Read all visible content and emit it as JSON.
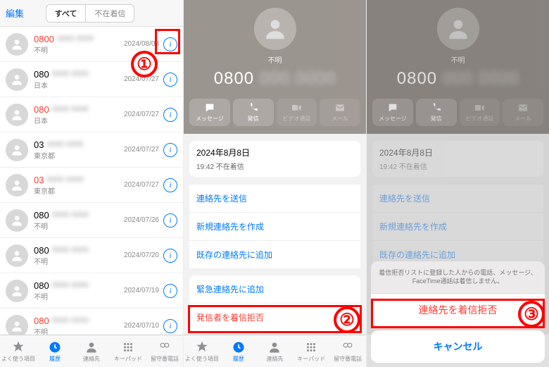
{
  "panel1": {
    "edit": "編集",
    "seg_all": "すべて",
    "seg_missed": "不在着信",
    "rows": [
      {
        "num": "0800",
        "missed": true,
        "sub": "不明",
        "date": "2024/08/08"
      },
      {
        "num": "080",
        "missed": false,
        "sub": "日本",
        "date": "2024/07/27"
      },
      {
        "num": "080",
        "missed": true,
        "sub": "日本",
        "date": "2024/07/27"
      },
      {
        "num": "03",
        "missed": false,
        "sub": "東京都",
        "date": "2024/07/27"
      },
      {
        "num": "03",
        "missed": true,
        "sub": "東京都",
        "date": "2024/07/27"
      },
      {
        "num": "080",
        "missed": false,
        "sub": "不明",
        "date": "2024/07/26"
      },
      {
        "num": "080",
        "missed": false,
        "sub": "不明",
        "date": "2024/07/20"
      },
      {
        "num": "080",
        "missed": false,
        "sub": "不明",
        "date": "2024/07/19"
      },
      {
        "num": "080",
        "missed": true,
        "sub": "不明",
        "date": "2024/07/10"
      }
    ],
    "tabs": [
      "よく使う項目",
      "履歴",
      "連絡先",
      "キーパッド",
      "留守番電話"
    ]
  },
  "contact": {
    "name": "不明",
    "number": "0800",
    "actions": [
      {
        "label": "メッセージ"
      },
      {
        "label": "発信"
      },
      {
        "label": "ビデオ通話"
      },
      {
        "label": "メール"
      }
    ],
    "date_line": "2024年8月8日",
    "time_line": "19:42  不在着信",
    "opts": {
      "share": "連絡先を送信",
      "newc": "新規連絡先を作成",
      "addc": "既存の連絡先に追加",
      "emerg": "緊急連絡先に追加",
      "block": "発信者を着信拒否"
    }
  },
  "sheet": {
    "warn": "着信拒否リストに登録した人からの電話、メッセージ、FaceTime通話は着信しません。",
    "block": "連絡先を着信拒否",
    "cancel": "キャンセル"
  },
  "callouts": {
    "c1": "①",
    "c2": "②",
    "c3": "③"
  }
}
